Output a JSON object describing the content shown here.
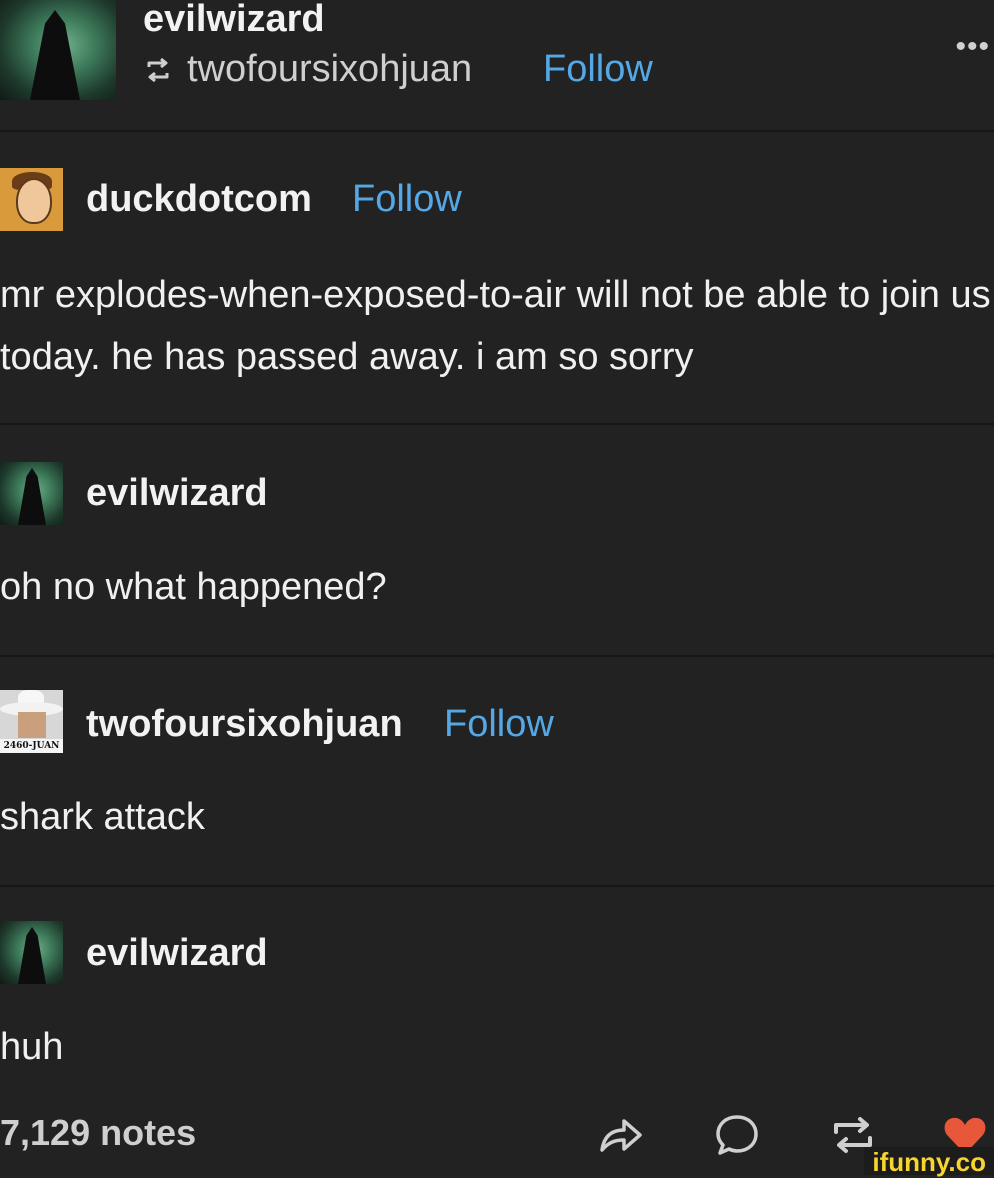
{
  "header": {
    "username": "evilwizard",
    "reblogged_from": "twofoursixohjuan",
    "follow_label": "Follow",
    "more_label": "•••"
  },
  "posts": [
    {
      "username": "duckdotcom",
      "follow_label": "Follow",
      "body": "mr explodes-when-exposed-to-air will not be able to join us today. he has passed away. i am so sorry"
    },
    {
      "username": "evilwizard",
      "body": "oh no what happened?"
    },
    {
      "username": "twofoursixohjuan",
      "follow_label": "Follow",
      "avatar_caption": "2460-JUAN",
      "body": "shark attack"
    },
    {
      "username": "evilwizard",
      "body": "huh"
    }
  ],
  "footer": {
    "notes": "7,129 notes",
    "icons": [
      "share-icon",
      "comment-icon",
      "reblog-icon",
      "like-icon"
    ],
    "like_color": "#e8573a"
  },
  "watermark": "ifunny.co",
  "colors": {
    "background": "#222222",
    "link": "#55a8e6",
    "text": "#f0f0f0"
  }
}
